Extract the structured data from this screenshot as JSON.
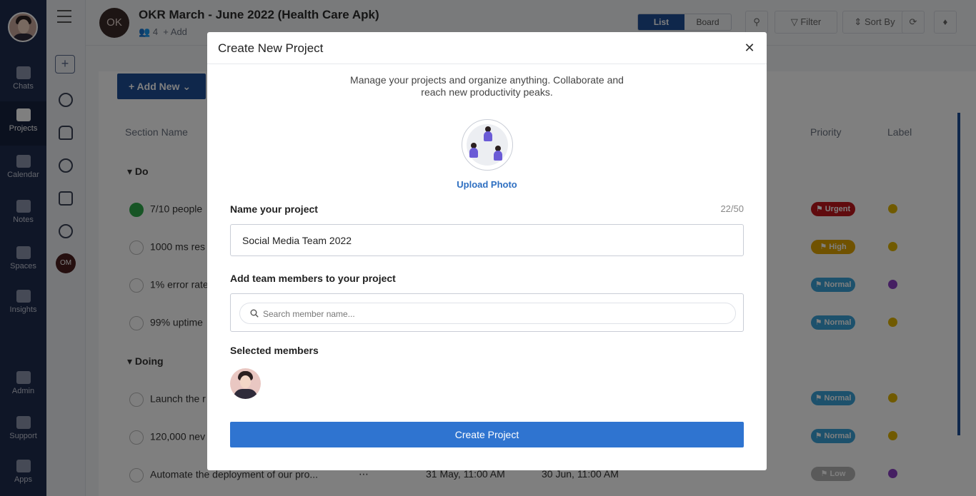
{
  "nav": {
    "items": [
      {
        "label": "Chats",
        "icon": "chat-icon"
      },
      {
        "label": "Projects",
        "icon": "projects-icon"
      },
      {
        "label": "Calendar",
        "icon": "calendar-icon"
      },
      {
        "label": "Notes",
        "icon": "notes-icon"
      },
      {
        "label": "Spaces",
        "icon": "spaces-icon"
      },
      {
        "label": "Insights",
        "icon": "insights-icon"
      },
      {
        "label": "Admin",
        "icon": "admin-icon"
      },
      {
        "label": "Support",
        "icon": "support-icon"
      },
      {
        "label": "Apps",
        "icon": "apps-icon"
      }
    ]
  },
  "rail": {
    "om_badge": "OM"
  },
  "header": {
    "project_initials": "OK",
    "project_title": "OKR March - June 2022 (Health Care Apk)",
    "member_count": "4",
    "add_label": "Add",
    "view_list": "List",
    "view_board": "Board",
    "filter_label": "Filter",
    "sort_label": "Sort By"
  },
  "list": {
    "add_new_label": "Add New",
    "columns": {
      "section": "Section Name",
      "priority": "Priority",
      "label": "Label"
    },
    "sections": [
      {
        "name": "Do"
      },
      {
        "name": "Doing"
      }
    ],
    "tasks": [
      {
        "text": "7/10 people",
        "done": true,
        "priority": "Urgent",
        "priority_color": "#c0171d",
        "label_color": "#e0b400"
      },
      {
        "text": "1000 ms res",
        "done": false,
        "priority": "High",
        "priority_color": "#e0a400",
        "label_color": "#e0b400"
      },
      {
        "text": "1% error rate",
        "done": false,
        "priority": "Normal",
        "priority_color": "#3aa3d9",
        "label_color": "#8a3fc4"
      },
      {
        "text": "99% uptime",
        "done": false,
        "priority": "Normal",
        "priority_color": "#3aa3d9",
        "label_color": "#e0b400"
      },
      {
        "text": "Launch the r",
        "done": false,
        "priority": "Normal",
        "priority_color": "#3aa3d9",
        "label_color": "#e0b400"
      },
      {
        "text": "120,000 nev",
        "done": false,
        "priority": "Normal",
        "priority_color": "#3aa3d9",
        "label_color": "#e0b400"
      },
      {
        "text": "Automate the deployment of our pro...",
        "done": false,
        "priority": "Low",
        "priority_color": "#b5b5b5",
        "label_color": "#8a3fc4"
      }
    ],
    "last_row": {
      "start": "31 May, 11:00 AM",
      "end": "30 Jun, 11:00 AM"
    }
  },
  "modal": {
    "title": "Create New Project",
    "intro": "Manage your projects and organize anything. Collaborate and reach new productivity peaks.",
    "upload_label": "Upload Photo",
    "name_label": "Name your project",
    "name_counter": "22/50",
    "name_value": "Social Media Team 2022",
    "members_label": "Add team members to your project",
    "search_placeholder": "Search member name...",
    "selected_label": "Selected members",
    "create_label": "Create Project"
  }
}
